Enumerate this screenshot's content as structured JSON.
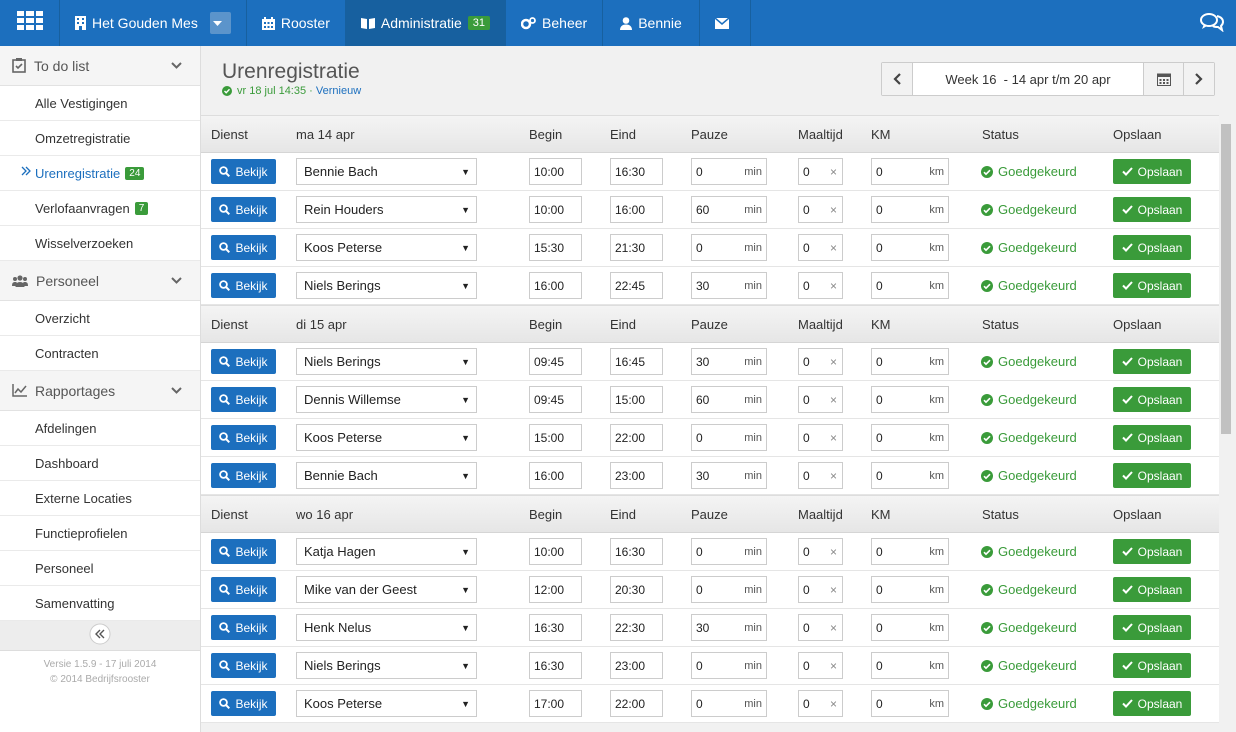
{
  "topbar": {
    "company": "Het Gouden Mes",
    "nav": [
      {
        "label": "Rooster"
      },
      {
        "label": "Administratie",
        "badge": "31"
      },
      {
        "label": "Beheer"
      },
      {
        "label": "Bennie"
      }
    ]
  },
  "sidebar": {
    "sections": [
      {
        "label": "To do list",
        "items": [
          {
            "label": "Alle Vestigingen"
          },
          {
            "label": "Omzetregistratie"
          },
          {
            "label": "Urenregistratie",
            "badge": "24"
          },
          {
            "label": "Verlofaanvragen",
            "badge": "7"
          },
          {
            "label": "Wisselverzoeken"
          }
        ]
      },
      {
        "label": "Personeel",
        "items": [
          {
            "label": "Overzicht"
          },
          {
            "label": "Contracten"
          }
        ]
      },
      {
        "label": "Rapportages",
        "items": [
          {
            "label": "Afdelingen"
          },
          {
            "label": "Dashboard"
          },
          {
            "label": "Externe Locaties"
          },
          {
            "label": "Functieprofielen"
          },
          {
            "label": "Personeel"
          },
          {
            "label": "Samenvatting"
          }
        ]
      }
    ],
    "version": "Versie 1.5.9 - 17 juli 2014",
    "copyright": "© 2014 Bedrijfsrooster"
  },
  "page": {
    "title": "Urenregistratie",
    "updated": "vr 18 jul 14:35",
    "sep": " · ",
    "refresh": "Vernieuw",
    "week": "Week 16  - 14 apr t/m 20 apr"
  },
  "columns": {
    "dienst": "Dienst",
    "begin": "Begin",
    "eind": "Eind",
    "pauze": "Pauze",
    "maaltijd": "Maaltijd",
    "km": "KM",
    "status": "Status",
    "opslaan": "Opslaan"
  },
  "labels": {
    "bekijk": "Bekijk",
    "opslaan": "Opslaan",
    "min": "min",
    "km": "km",
    "x": "×"
  },
  "days": [
    {
      "label": "ma 14 apr",
      "rows": [
        {
          "name": "Bennie Bach",
          "begin": "10:00",
          "eind": "16:30",
          "pauze": "0",
          "maaltijd": "0",
          "km": "0",
          "status": "Goedgekeurd"
        },
        {
          "name": "Rein Houders",
          "begin": "10:00",
          "eind": "16:00",
          "pauze": "60",
          "maaltijd": "0",
          "km": "0",
          "status": "Goedgekeurd"
        },
        {
          "name": "Koos Peterse",
          "begin": "15:30",
          "eind": "21:30",
          "pauze": "0",
          "maaltijd": "0",
          "km": "0",
          "status": "Goedgekeurd"
        },
        {
          "name": "Niels Berings",
          "begin": "16:00",
          "eind": "22:45",
          "pauze": "30",
          "maaltijd": "0",
          "km": "0",
          "status": "Goedgekeurd"
        }
      ]
    },
    {
      "label": "di 15 apr",
      "rows": [
        {
          "name": "Niels Berings",
          "begin": "09:45",
          "eind": "16:45",
          "pauze": "30",
          "maaltijd": "0",
          "km": "0",
          "status": "Goedgekeurd"
        },
        {
          "name": "Dennis Willemse",
          "begin": "09:45",
          "eind": "15:00",
          "pauze": "60",
          "maaltijd": "0",
          "km": "0",
          "status": "Goedgekeurd"
        },
        {
          "name": "Koos Peterse",
          "begin": "15:00",
          "eind": "22:00",
          "pauze": "0",
          "maaltijd": "0",
          "km": "0",
          "status": "Goedgekeurd"
        },
        {
          "name": "Bennie Bach",
          "begin": "16:00",
          "eind": "23:00",
          "pauze": "30",
          "maaltijd": "0",
          "km": "0",
          "status": "Goedgekeurd"
        }
      ]
    },
    {
      "label": "wo 16 apr",
      "rows": [
        {
          "name": "Katja Hagen",
          "begin": "10:00",
          "eind": "16:30",
          "pauze": "0",
          "maaltijd": "0",
          "km": "0",
          "status": "Goedgekeurd"
        },
        {
          "name": "Mike van der Geest",
          "begin": "12:00",
          "eind": "20:30",
          "pauze": "0",
          "maaltijd": "0",
          "km": "0",
          "status": "Goedgekeurd"
        },
        {
          "name": "Henk Nelus",
          "begin": "16:30",
          "eind": "22:30",
          "pauze": "30",
          "maaltijd": "0",
          "km": "0",
          "status": "Goedgekeurd"
        },
        {
          "name": "Niels Berings",
          "begin": "16:30",
          "eind": "23:00",
          "pauze": "0",
          "maaltijd": "0",
          "km": "0",
          "status": "Goedgekeurd"
        },
        {
          "name": "Koos Peterse",
          "begin": "17:00",
          "eind": "22:00",
          "pauze": "0",
          "maaltijd": "0",
          "km": "0",
          "status": "Goedgekeurd"
        }
      ]
    }
  ],
  "colors": {
    "brand": "#1c6fbe",
    "success": "#3a9b3a"
  }
}
